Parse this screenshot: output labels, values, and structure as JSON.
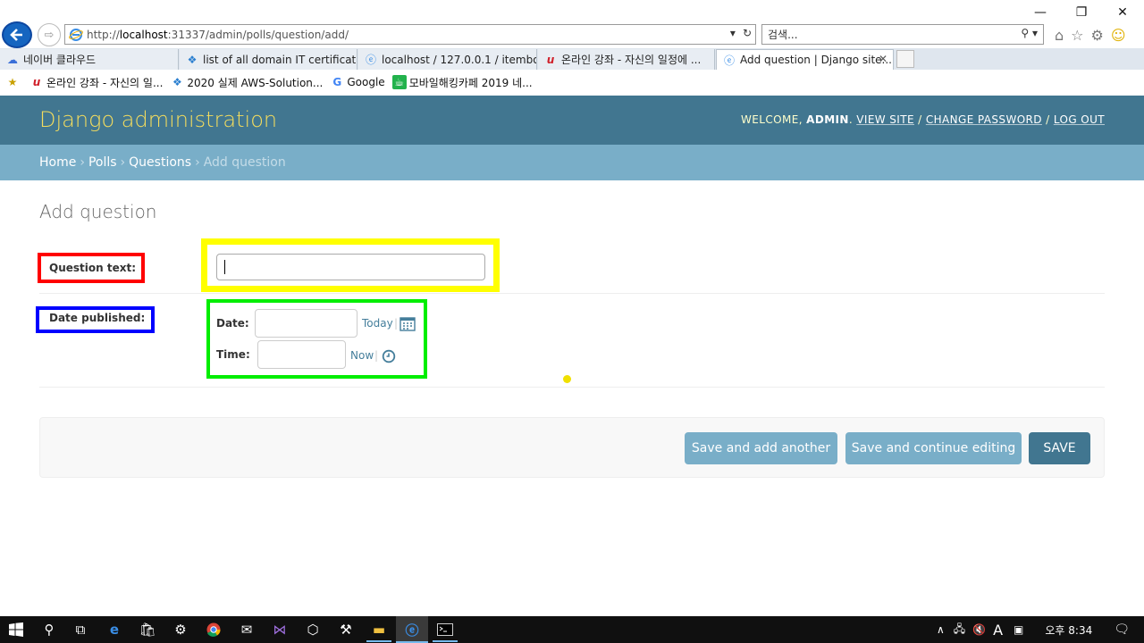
{
  "browser": {
    "address_url_prefix": "http://",
    "address_host": "localhost",
    "address_path": ":31337/admin/polls/question/add/",
    "search_placeholder": "검색...",
    "tabs": [
      {
        "label": "네이버 클라우드",
        "icon": "naver-cloud-icon"
      },
      {
        "label": "list of all domain IT certificati...",
        "icon": "puzzle-icon"
      },
      {
        "label": "localhost / 127.0.0.1 / itembo...",
        "icon": "ie-icon"
      },
      {
        "label": "온라인 강좌 - 자신의 일정에 ...",
        "icon": "udemy-icon"
      },
      {
        "label": "Add question | Django site...",
        "icon": "ie-icon",
        "active": true
      }
    ],
    "favorites": [
      {
        "label": "온라인 강좌 - 자신의 일...",
        "icon": "udemy-icon"
      },
      {
        "label": "2020 실제 AWS-Solution...",
        "icon": "puzzle-icon"
      },
      {
        "label": "Google",
        "icon": "google-icon"
      },
      {
        "label": "모바일해킹카페 2019   네...",
        "icon": "cafe-icon"
      }
    ]
  },
  "admin": {
    "brand": "Django administration",
    "welcome": "WELCOME, ",
    "username": "ADMIN",
    "view_site": "VIEW SITE",
    "change_password": "CHANGE PASSWORD",
    "log_out": "LOG OUT",
    "separator": " / "
  },
  "breadcrumbs": {
    "home": "Home",
    "polls": "Polls",
    "questions": "Questions",
    "current": "Add question",
    "sep": "›"
  },
  "form": {
    "title": "Add question",
    "question_text_label": "Question text:",
    "question_text_value": "",
    "date_published_label": "Date published:",
    "date_label": "Date:",
    "time_label": "Time:",
    "date_value": "",
    "time_value": "",
    "today_link": "Today",
    "now_link": "Now",
    "link_sep": "|"
  },
  "buttons": {
    "save_add_another": "Save and add another",
    "save_continue": "Save and continue editing",
    "save": "SAVE"
  },
  "taskbar": {
    "time": "오후 8:34",
    "ime": "A"
  },
  "colors": {
    "header": "#417690",
    "breadcrumb": "#79aec8",
    "brand": "#f5dd5d",
    "highlight_red": "#ff0000",
    "highlight_blue": "#0000ff",
    "highlight_yellow": "#ffff00",
    "highlight_green": "#00ee00"
  }
}
